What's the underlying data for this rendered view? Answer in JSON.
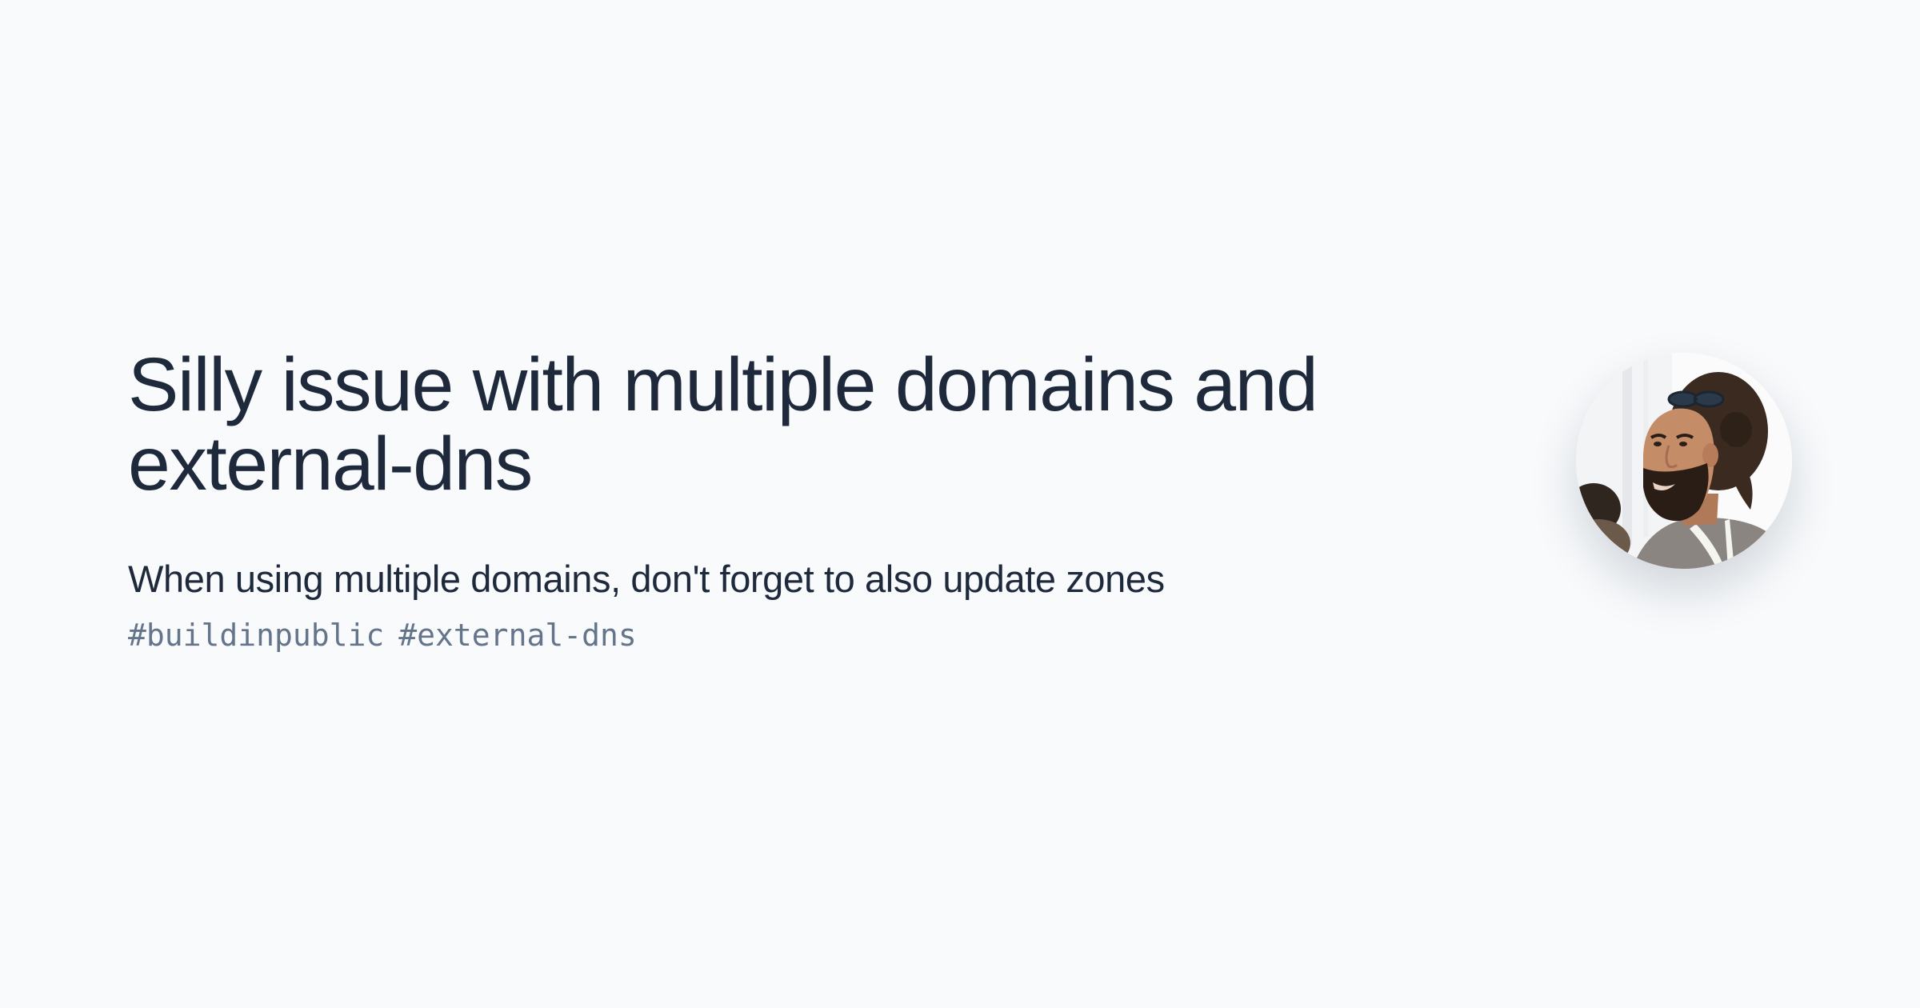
{
  "post": {
    "title": "Silly issue with multiple domains and external-dns",
    "description": "When using multiple domains, don't forget to also update zones",
    "tags": [
      "#buildinpublic",
      "#external-dns"
    ]
  },
  "author": {
    "avatar_icon": "author-photo-avatar"
  },
  "colors": {
    "background": "#f8fafc",
    "title": "#1e293b",
    "tags": "#64748b"
  }
}
